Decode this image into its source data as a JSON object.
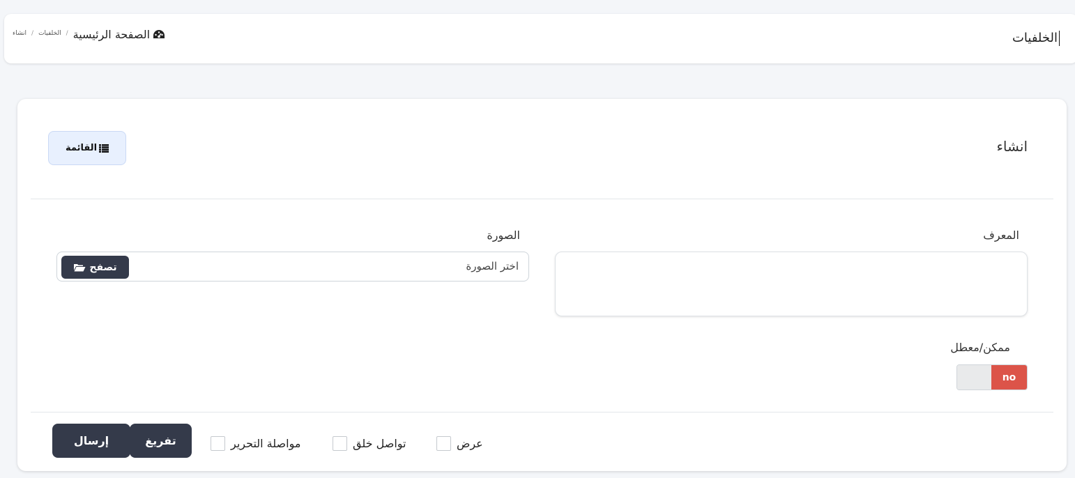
{
  "header": {
    "title": "الخلفيات",
    "breadcrumb": {
      "home": "الصفحة الرئيسية",
      "section": "الخلفيات",
      "current": "انشاء",
      "separator": "/"
    }
  },
  "card": {
    "title": "انشاء",
    "list_button": "القائمة",
    "fields": {
      "id_label": "المعرف",
      "id_value": "",
      "image_label": "الصورة",
      "image_placeholder": "اختر الصورة",
      "browse_button": "تصفح",
      "enabled_label": "ممكن/معطل",
      "toggle_text": "no"
    },
    "footer": {
      "submit": "إرسال",
      "reset": "تفريغ",
      "checkboxes": [
        "مواصلة التحرير",
        "تواصل خلق",
        "عرض"
      ]
    }
  },
  "colors": {
    "primary_dark": "#343a4a",
    "toggle_off_red": "#dc5449",
    "list_button_bg": "#e8f0fe"
  },
  "icons": {
    "home": "dashboard-gauge-icon",
    "list": "list-icon",
    "browse": "folder-open-icon"
  }
}
